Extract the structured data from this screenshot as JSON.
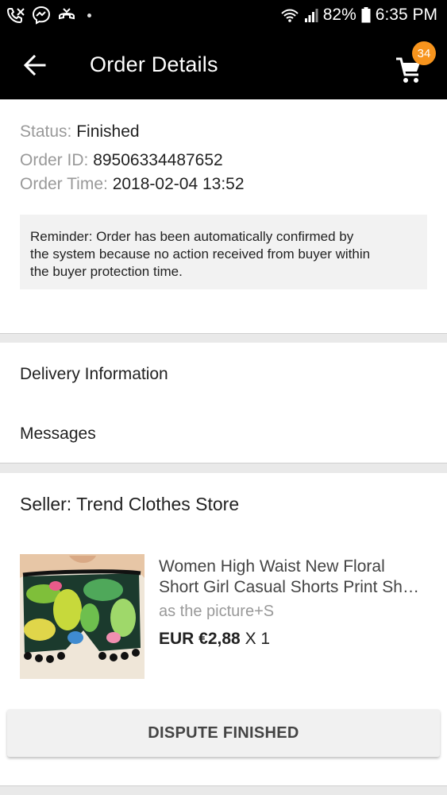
{
  "status_bar": {
    "battery": "82%",
    "time": "6:35 PM",
    "icons": [
      "missed-call-icon",
      "messenger-icon",
      "call-icon",
      "wifi-icon",
      "signal-icon",
      "battery-icon"
    ]
  },
  "header": {
    "title": "Order Details",
    "cart_count": "34",
    "icons": [
      "back-arrow-icon",
      "cart-icon"
    ]
  },
  "order": {
    "status_label": "Status:",
    "status_value": "Finished",
    "id_label": "Order ID:",
    "id_value": "89506334487652",
    "time_label": "Order Time:",
    "time_value": "2018-02-04 13:52",
    "reminder": {
      "line1": "Reminder: Order has been automatically confirmed by",
      "line2": "the system because no action received from buyer within",
      "line3": "the buyer protection time."
    }
  },
  "menu": {
    "delivery": "Delivery Information",
    "messages": "Messages"
  },
  "seller": {
    "label": "Seller: Trend Clothes Store"
  },
  "product": {
    "title_line1": "Women High Waist New Floral",
    "title_line2": "Short Girl Casual Shorts Print Sh…",
    "variant": "as the picture+S",
    "price": "EUR €2,88",
    "quantity": "X 1"
  },
  "actions": {
    "dispute": "DISPUTE FINISHED"
  },
  "colors": {
    "badge": "#f7941d",
    "header_bg": "#000000",
    "page_bg": "#e9e9e9"
  }
}
